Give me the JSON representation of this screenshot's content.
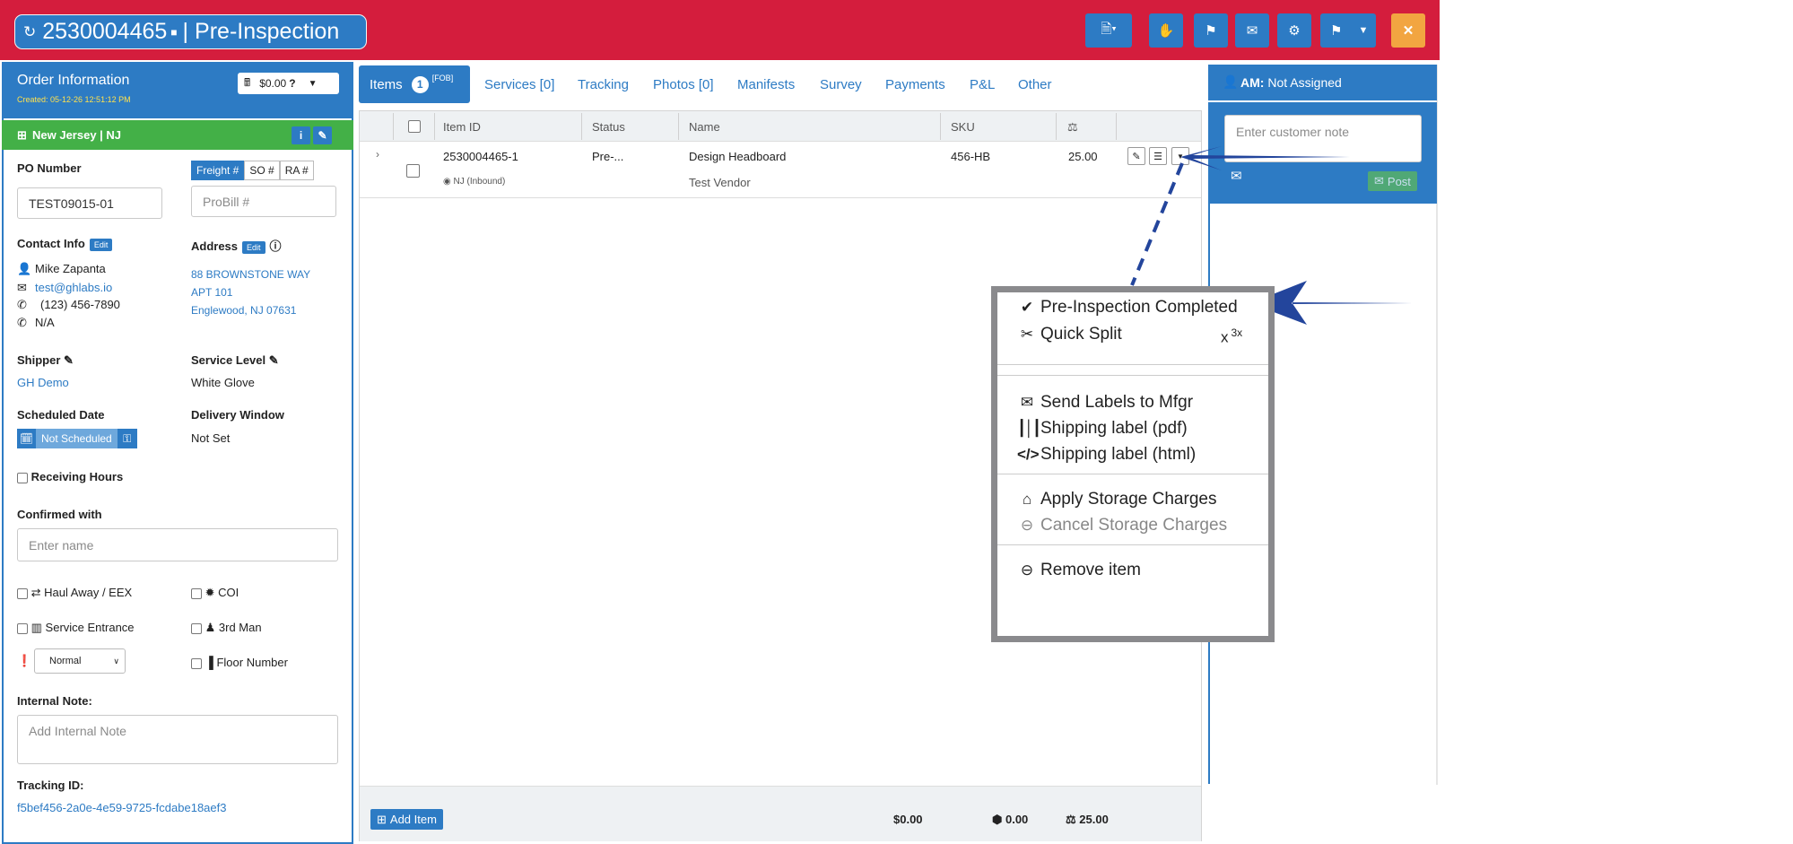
{
  "header": {
    "order_id": "2530004465",
    "stage": "Pre-Inspection",
    "title_separator": "|",
    "brand_color": "#d41d3d",
    "accent_color": "#2d7bc4",
    "toolbar_icons": [
      "document-dropdown-icon",
      "hand-stop-icon",
      "flag-icon",
      "envelope-icon",
      "gear-icon",
      "share-dropdown-icon",
      "caret-down-icon",
      "close-icon"
    ]
  },
  "order": {
    "title": "Order Information",
    "created": "Created: 05-12-26 12:51:12 PM",
    "balance": "$0.00",
    "location": "New Jersey | NJ",
    "po_label": "PO Number",
    "po_value": "TEST09015-01",
    "freight_tabs": [
      "Freight #",
      "SO #",
      "RA #"
    ],
    "probill_placeholder": "ProBill #",
    "contact_label": "Contact Info",
    "edit": "Edit",
    "contact_name": "Mike Zapanta",
    "contact_email": "test@ghlabs.io",
    "contact_phone": "(123) 456-7890",
    "contact_alt_phone": "N/A",
    "address_label": "Address",
    "address_line1": "88 BROWNSTONE WAY",
    "address_line2": "APT 101",
    "address_line3": "Englewood, NJ 07631",
    "shipper_label": "Shipper",
    "shipper_value": "GH Demo",
    "service_label": "Service Level",
    "service_value": "White Glove",
    "scheduled_label": "Scheduled Date",
    "scheduled_value": "Not Scheduled",
    "window_label": "Delivery Window",
    "window_value": "Not Set",
    "receiving_hours": "Receiving Hours",
    "confirmed_label": "Confirmed with",
    "confirmed_placeholder": "Enter name",
    "haul_away": "Haul Away / EEX",
    "coi": "COI",
    "service_entrance": "Service Entrance",
    "third_man": "3rd Man",
    "priority": "Normal",
    "floor_number": "Floor Number",
    "internal_note_label": "Internal Note:",
    "internal_note_placeholder": "Add Internal Note",
    "tracking_label": "Tracking ID:",
    "tracking_value": "f5bef456-2a0e-4e59-9725-fcdabe18aef3"
  },
  "tabs": {
    "items": "Items",
    "items_count": "1",
    "items_sup": "[FOB]",
    "others": [
      "Services [0]",
      "Tracking",
      "Photos [0]",
      "Manifests",
      "Survey",
      "Payments",
      "P&L",
      "Other"
    ]
  },
  "grid": {
    "columns": [
      "Item ID",
      "Status",
      "Name",
      "SKU"
    ],
    "rows": [
      {
        "item_id": "2530004465-1",
        "location": "NJ (Inbound)",
        "status": "Pre-...",
        "name": "Design Headboard",
        "vendor": "Test Vendor",
        "sku": "456-HB",
        "weight": "25.00"
      }
    ],
    "add_item": "Add Item",
    "total_amount": "$0.00",
    "total_cube": "0.00",
    "total_weight": "25.00"
  },
  "right": {
    "am_label": "AM:",
    "am_value": "Not Assigned",
    "note_placeholder": "Enter customer note",
    "post": "Post"
  },
  "menu": {
    "items": [
      {
        "label": "Pre-Inspection Completed",
        "icon": "check-icon"
      },
      {
        "label": "Quick Split",
        "icon": "scissors-icon",
        "suffix": "x",
        "sup": "3x"
      },
      {
        "label": "Send Labels to Mfgr",
        "icon": "envelope-icon"
      },
      {
        "label": "Shipping label (pdf)",
        "icon": "barcode-icon"
      },
      {
        "label": "Shipping label (html)",
        "icon": "code-icon"
      },
      {
        "label": "Apply Storage Charges",
        "icon": "warehouse-icon"
      },
      {
        "label": "Cancel Storage Charges",
        "icon": "minus-circle-icon",
        "disabled": true
      },
      {
        "label": "Remove item",
        "icon": "minus-circle-icon"
      }
    ]
  }
}
